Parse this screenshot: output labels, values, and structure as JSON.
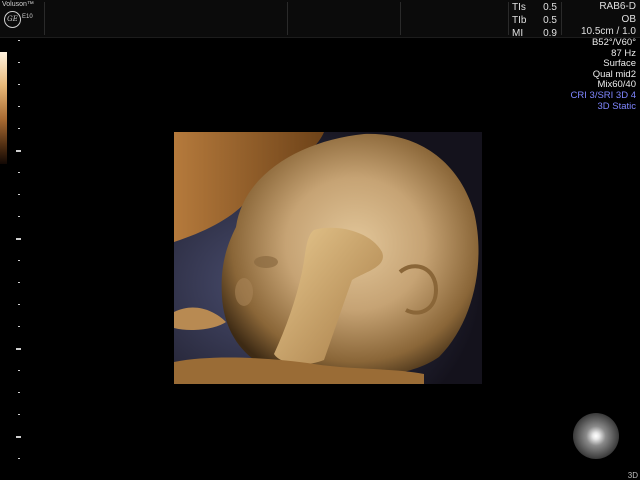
{
  "header": {
    "brand": "Voluson™",
    "logo_text": "GE",
    "model": "E10",
    "safety": [
      {
        "label": "TIs",
        "value": "0.5"
      },
      {
        "label": "TIb",
        "value": "0.5"
      },
      {
        "label": "MI",
        "value": "0.9"
      }
    ],
    "probe": "RAB6-D",
    "preset": "OB",
    "depth": "10.5cm / 1.0"
  },
  "params": {
    "angles": "B52°/V60°",
    "frame_rate": "87 Hz",
    "render_mode": "Surface",
    "quality": "Qual mid2",
    "mix": "Mix60/40",
    "cri": "CRI 3/SRI 3D 4",
    "static": "3D Static"
  },
  "footer": {
    "mode_label": "3D"
  },
  "colors": {
    "accent_blue": "#7f86ff",
    "skin_tone": "#c9a877"
  }
}
